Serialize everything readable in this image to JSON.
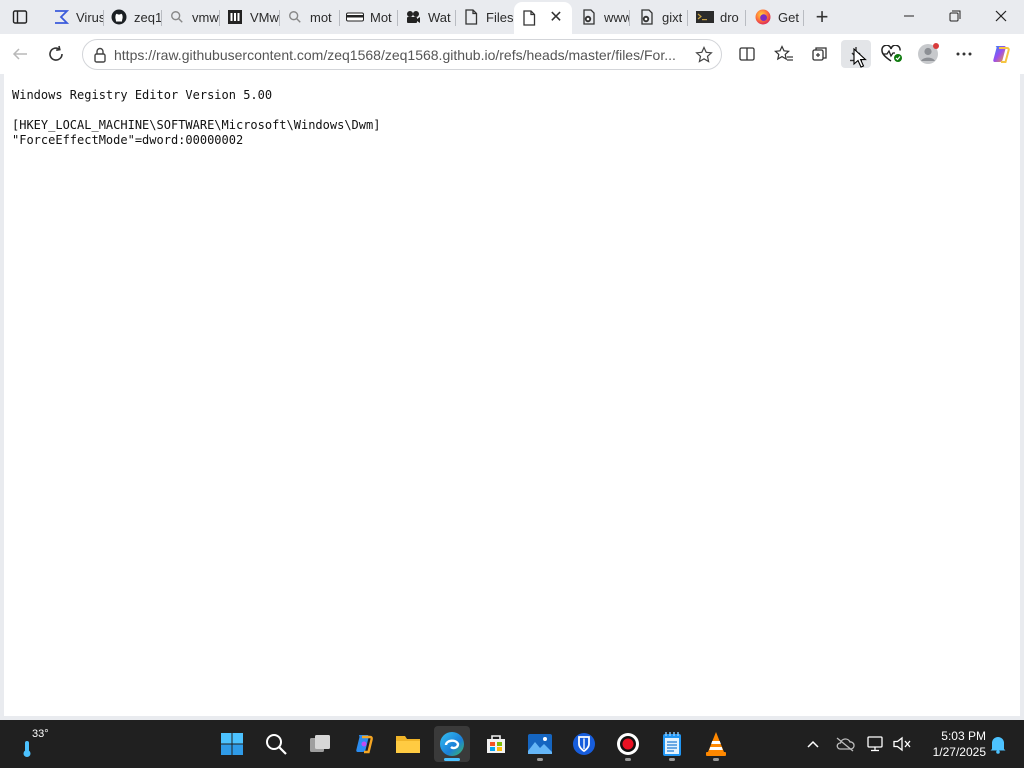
{
  "browser": {
    "tabs": [
      {
        "label": "Virus",
        "icon": "sigma-icon"
      },
      {
        "label": "zeq1",
        "icon": "github-icon"
      },
      {
        "label": "vmw",
        "icon": "search-icon"
      },
      {
        "label": "VMw",
        "icon": "bank-icon"
      },
      {
        "label": "mot",
        "icon": "search-icon"
      },
      {
        "label": "Mot",
        "icon": "keyboard-icon"
      },
      {
        "label": "Wat",
        "icon": "film-icon"
      },
      {
        "label": "Files",
        "icon": "document-icon"
      },
      {
        "label": "",
        "icon": "document-icon",
        "active": true
      },
      {
        "label": "www",
        "icon": "copilot-doc-icon"
      },
      {
        "label": "gixt",
        "icon": "copilot-doc-icon"
      },
      {
        "label": "dro",
        "icon": "terminal-icon"
      },
      {
        "label": "Get",
        "icon": "firefox-icon"
      }
    ],
    "address": {
      "url": "https://raw.githubusercontent.com/zeq1568/zeq1568.github.io/refs/heads/master/files/For..."
    }
  },
  "page": {
    "lines": [
      "Windows Registry Editor Version 5.00",
      "",
      "[HKEY_LOCAL_MACHINE\\SOFTWARE\\Microsoft\\Windows\\Dwm]",
      "\"ForceEffectMode\"=dword:00000002"
    ]
  },
  "taskbar": {
    "weather": {
      "temp": "33°"
    },
    "apps": [
      "start",
      "search",
      "task-view",
      "copilot",
      "file-explorer",
      "edge",
      "store",
      "photos",
      "bitwarden",
      "recorder",
      "notepad",
      "vlc"
    ],
    "clock": {
      "time": "5:03 PM",
      "date": "1/27/2025"
    }
  },
  "colors": {
    "accent": "#0078d4",
    "taskbar": "#202020",
    "tabstrip": "#e9ebef"
  }
}
